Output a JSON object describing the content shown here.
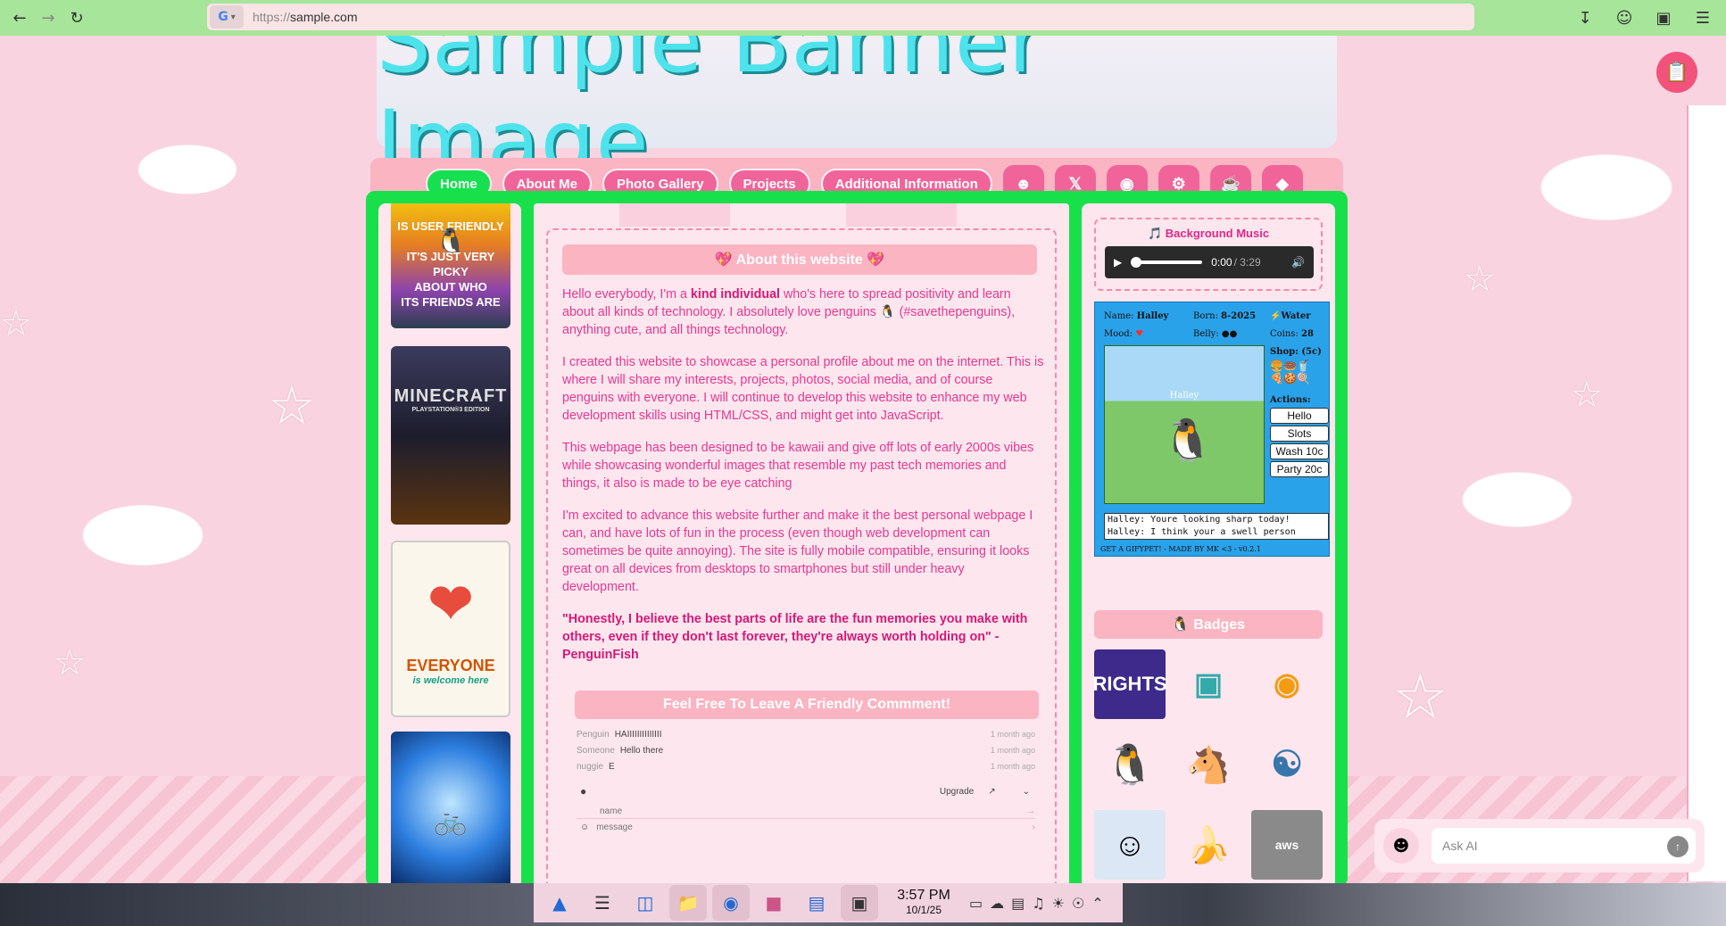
{
  "browser": {
    "url_protocol": "https://",
    "url_host": "sample.com",
    "search_engine_badge": "G"
  },
  "banner": {
    "text": "Sample Banner Image"
  },
  "nav": {
    "items": [
      "Home",
      "About Me",
      "Photo Gallery",
      "Projects",
      "Additional Information"
    ],
    "social_icons": [
      "avatar-icon",
      "x-icon",
      "github-icon",
      "steam-icon",
      "buymeacoffee-icon",
      "discord-icon"
    ]
  },
  "left_column": {
    "thumb1_lines": [
      "IS USER FRIENDLY",
      "IT'S JUST VERY PICKY",
      "ABOUT WHO",
      "ITS FRIENDS ARE"
    ],
    "thumb2_title": "MINECRAFT",
    "thumb2_subtitle": "PLAYSTATION®3 EDITION",
    "thumb3_title": "EVERYONE",
    "thumb3_subtitle": "is welcome here"
  },
  "about": {
    "title": "💖 About this website 💖",
    "p1_pre": "Hello everybody, I'm a ",
    "p1_bold": "kind individual",
    "p1_post": " who's here to spread positivity and learn about all kinds of technology. I absolutely love penguins 🐧 (#savethepenguins), anything cute, and all things technology.",
    "p2": "I created this website to showcase a personal profile about me on the internet. This is where I will share my interests, projects, photos, social media, and of course penguins with everyone. I will continue to develop this website to enhance my web development skills using HTML/CSS, and might get into JavaScript.",
    "p3": "This webpage has been designed to be kawaii and give off lots of early 2000s vibes while showcasing wonderful images that resemble my past tech memories and things, it also is made to be eye catching",
    "p4": "I'm excited to advance this website further and make it the best personal webpage I can, and have lots of fun in the process (even though web development can sometimes be quite annoying). The site is fully mobile compatible, ensuring it looks great on all devices from desktops to smartphones but still under heavy development.",
    "quote": "\"Honestly, I believe the best parts of life are the fun memories you make with others, even if they don't last forever, they're always worth holding on\" - PenguinFish"
  },
  "comments": {
    "title": "Feel Free To Leave A Friendly Commment!",
    "items": [
      {
        "name": "Penguin",
        "text": "HAIIIIIIIIIIIIII",
        "time": "1 month ago"
      },
      {
        "name": "Someone",
        "text": "Hello there",
        "time": "1 month ago"
      },
      {
        "name": "nuggie",
        "text": "E",
        "time": "1 month ago"
      }
    ],
    "upgrade_label": "Upgrade",
    "name_placeholder": "name",
    "message_placeholder": "message"
  },
  "music": {
    "title": "🎵 Background Music",
    "time": "0:00",
    "duration": "/ 3:29"
  },
  "pet": {
    "name_label": "Name:",
    "name": "Halley",
    "born_label": "Born:",
    "born": "8-2025",
    "water": "Water",
    "mood_label": "Mood:",
    "belly_label": "Belly:",
    "coins_label": "Coins:",
    "coins": "28",
    "shop_label": "Shop: (5c)",
    "actions_label": "Actions:",
    "pet_caption": "Halley",
    "actions": [
      "Hello",
      "Slots",
      "Wash 10c",
      "Party 20c"
    ],
    "log": [
      "Halley: Youre looking sharp today!",
      "Halley: I think your a swell person"
    ],
    "footer": "GET A GIFYPET! - MADE BY MK <3 - v0.2.1"
  },
  "badges": {
    "title": "🐧 Badges",
    "items": [
      "RIGHTS",
      "",
      "",
      "",
      "",
      "",
      "",
      "",
      "aws"
    ]
  },
  "ask_ai": {
    "placeholder": "Ask AI"
  },
  "taskbar": {
    "time": "3:57 PM",
    "date": "10/1/25"
  }
}
